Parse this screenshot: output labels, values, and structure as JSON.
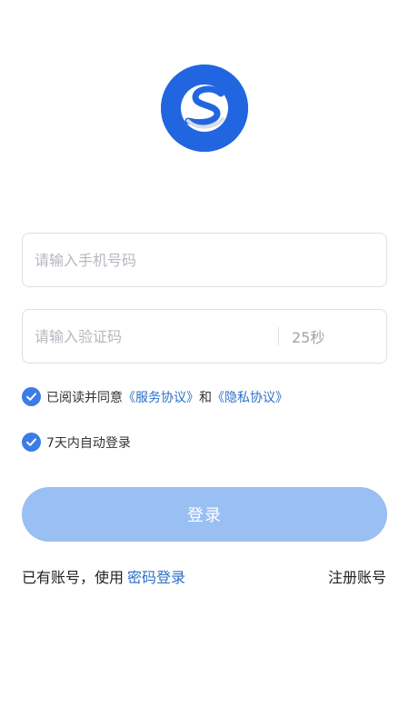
{
  "logo": {
    "icon": "road-s-logo-icon",
    "color": "#2166e0"
  },
  "form": {
    "phone": {
      "placeholder": "请输入手机号码",
      "value": ""
    },
    "code": {
      "placeholder": "请输入验证码",
      "value": "",
      "countdown": "25秒"
    }
  },
  "agreement": {
    "checked": true,
    "prefix": "已阅读并同意",
    "service_link": "《服务协议》",
    "conjunction": "和",
    "privacy_link": "《隐私协议》"
  },
  "auto_login": {
    "checked": true,
    "label": "7天内自动登录"
  },
  "login_button": {
    "label": "登录"
  },
  "footer": {
    "prompt": "已有账号，使用",
    "password_login": "密码登录",
    "register": "注册账号"
  },
  "colors": {
    "accent": "#3c7ce6",
    "link": "#2d6fc7",
    "button": "#99bff3"
  }
}
